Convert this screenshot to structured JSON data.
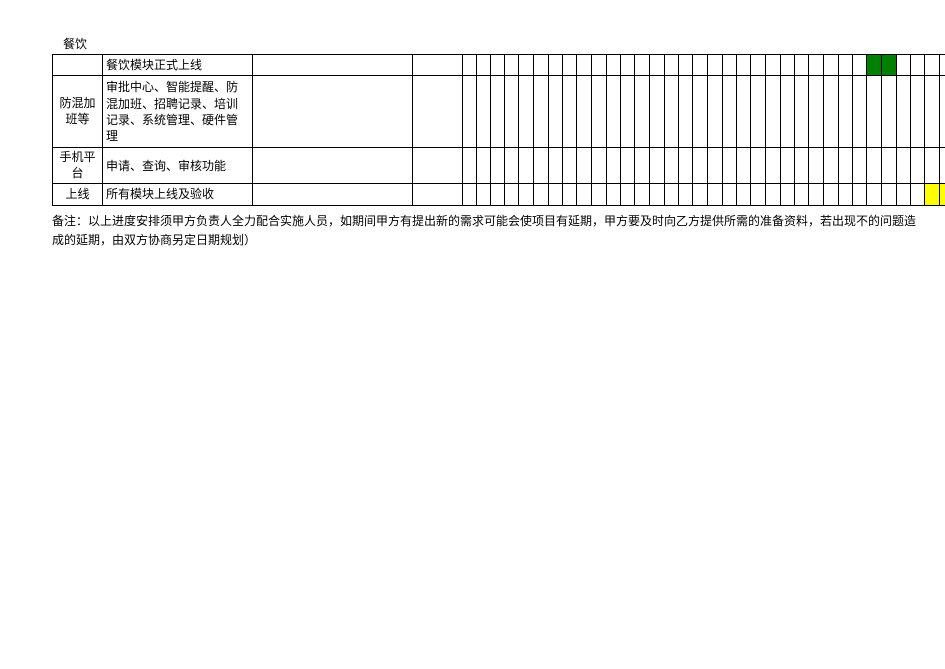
{
  "header": {
    "catering_label": "餐饮"
  },
  "rows": [
    {
      "category": "",
      "task": "餐饮模块正式上线",
      "fills": {
        "28": "green",
        "29": "green"
      }
    },
    {
      "category": "防混加班等",
      "task": "审批中心、智能提醒、防混加班、招聘记录、培训记录、系统管理、硬件管理",
      "fills": {}
    },
    {
      "category": "手机平台",
      "task": "申请、查询、审核功能",
      "fills": {}
    },
    {
      "category": "上线",
      "task": "所有模块上线及验收",
      "fills": {
        "32": "yellow",
        "33": "yellow",
        "34": "yellow"
      }
    }
  ],
  "note": "备注：以上进度安排须甲方负责人全力配合实施人员，如期间甲方有提出新的需求可能会使项目有延期，甲方要及时向乙方提供所需的准备资料，若出现不的问题造成的延期，由双方协商另定日期规划）",
  "gantt_columns": 35
}
